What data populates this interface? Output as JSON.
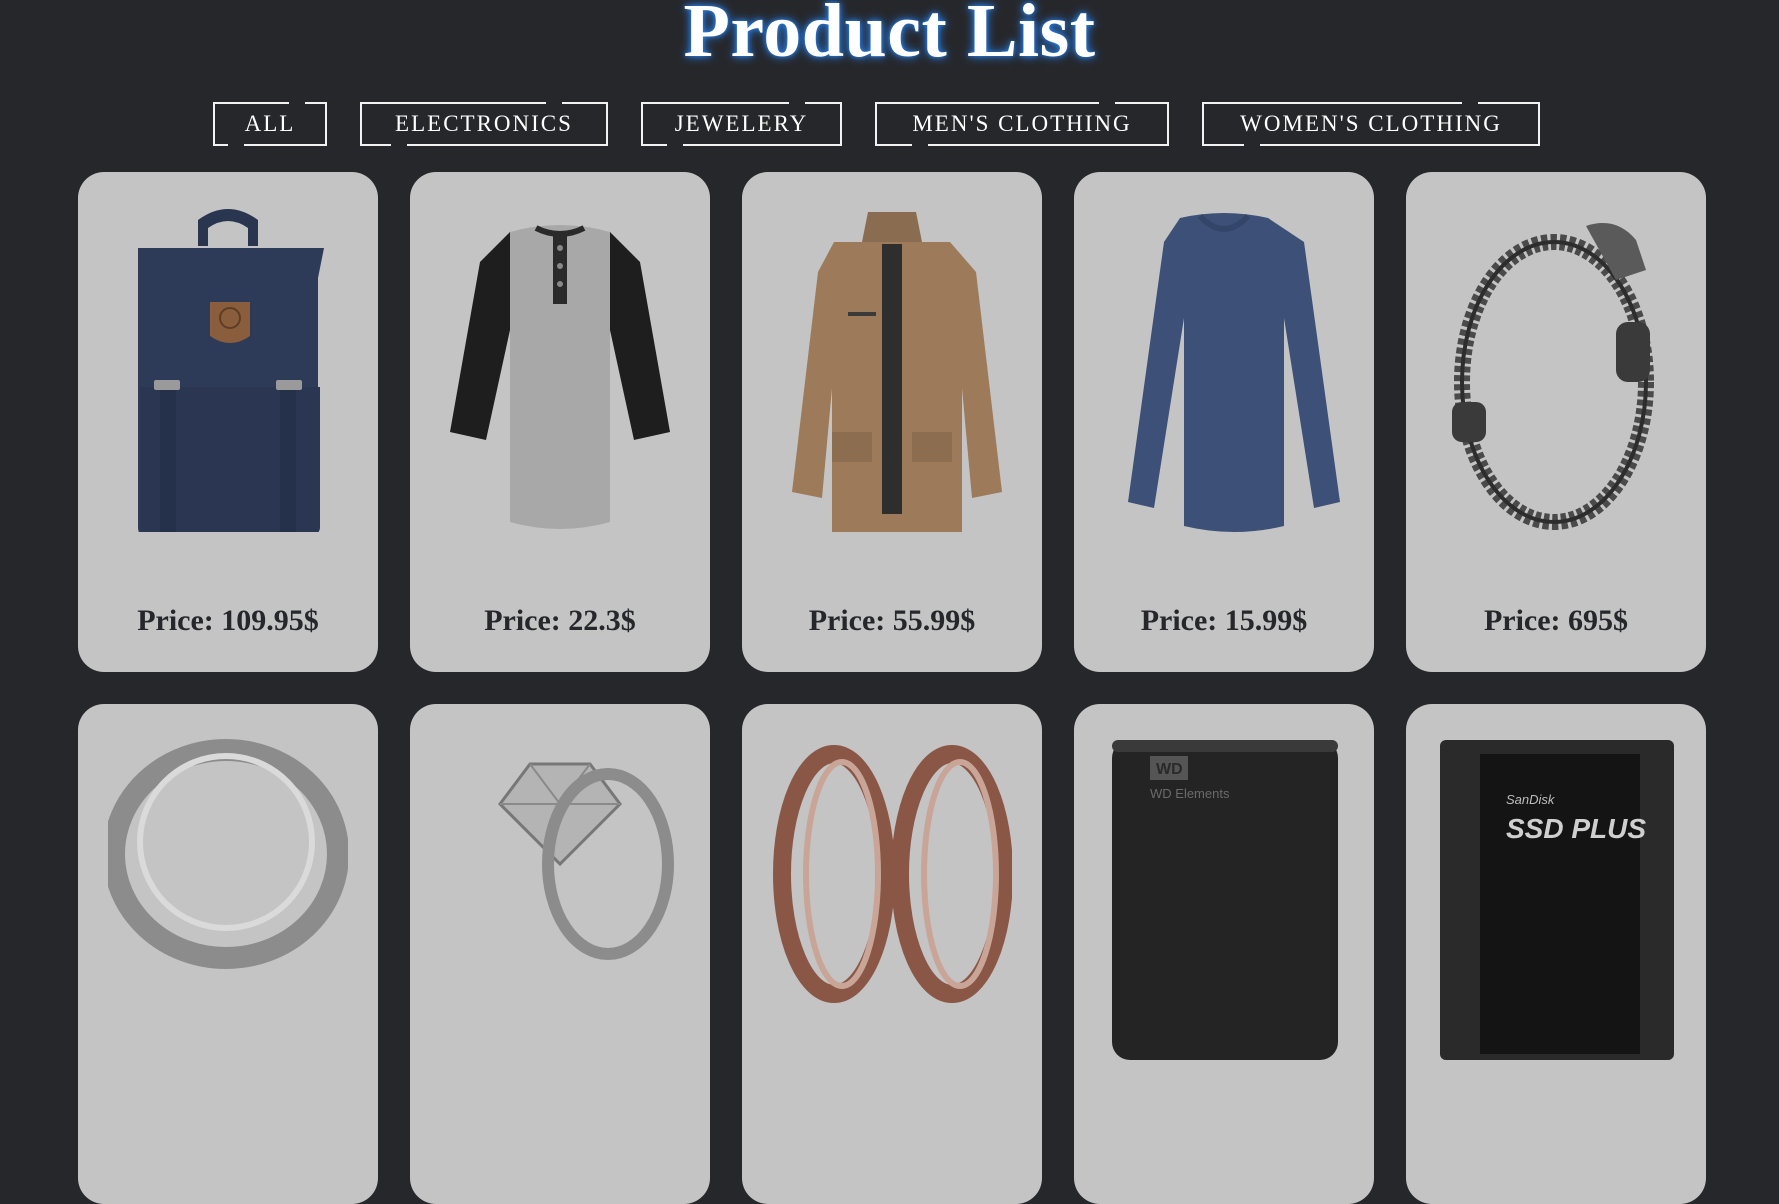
{
  "title": "Product List",
  "filters": [
    "ALL",
    "ELECTRONICS",
    "JEWELERY",
    "MEN'S CLOTHING",
    "WOMEN'S CLOTHING"
  ],
  "products": [
    {
      "icon": "backpack-image",
      "price": "Price: 109.95$"
    },
    {
      "icon": "raglan-tshirt-image",
      "price": "Price: 22.3$"
    },
    {
      "icon": "jacket-image",
      "price": "Price: 55.99$"
    },
    {
      "icon": "long-sleeve-shirt-image",
      "price": "Price: 15.99$"
    },
    {
      "icon": "bracelet-image",
      "price": "Price: 695$"
    },
    {
      "icon": "silver-ring-image",
      "price": ""
    },
    {
      "icon": "diamond-ring-image",
      "price": ""
    },
    {
      "icon": "rose-gold-rings-image",
      "price": ""
    },
    {
      "icon": "hard-drive-image",
      "price": ""
    },
    {
      "icon": "ssd-image",
      "price": ""
    }
  ],
  "ssd_brand": "SanDisk",
  "ssd_label": "SSD PLUS",
  "hdd_label": "WD Elements",
  "hdd_logo": "WD"
}
